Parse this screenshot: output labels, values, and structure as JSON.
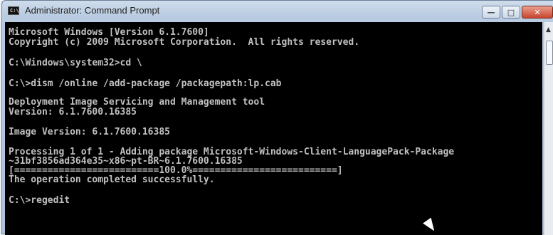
{
  "window": {
    "title": "Administrator: Command Prompt",
    "icon_label": "C:\\"
  },
  "controls": {
    "minimize": "—",
    "maximize": "□",
    "close": "✕"
  },
  "console": {
    "lines": [
      "Microsoft Windows [Version 6.1.7600]",
      "Copyright (c) 2009 Microsoft Corporation.  All rights reserved.",
      "C:\\Windows\\system32>cd \\",
      "C:\\>dism /online /add-package /packagepath:lp.cab",
      "Deployment Image Servicing and Management tool",
      "Version: 6.1.7600.16385",
      "Image Version: 6.1.7600.16385",
      "Processing 1 of 1 - Adding package Microsoft-Windows-Client-LanguagePack-Package",
      "~31bf3856ad364e35~x86~pt-BR~6.1.7600.16385",
      "[==========================100.0%==========================]",
      "The operation completed successfully.",
      "C:\\>regedit"
    ]
  },
  "scrollbar": {
    "up_arrow": "▲"
  }
}
